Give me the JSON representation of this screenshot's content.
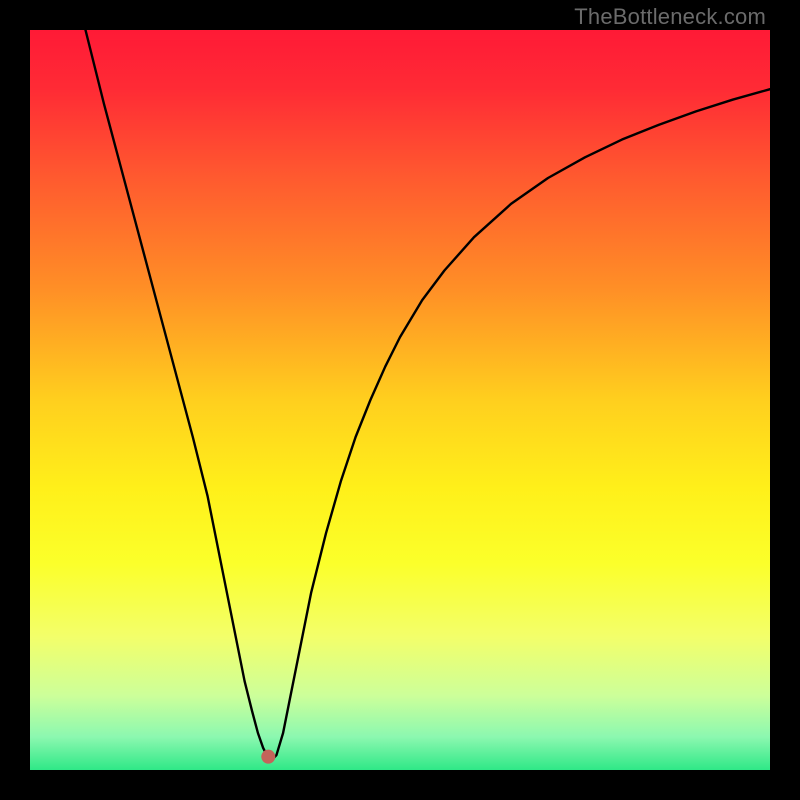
{
  "watermark": "TheBottleneck.com",
  "chart_data": {
    "type": "line",
    "title": "",
    "xlabel": "",
    "ylabel": "",
    "xlim": [
      0,
      100
    ],
    "ylim": [
      0,
      100
    ],
    "background_gradient": {
      "stops": [
        {
          "offset": 0.0,
          "color": "#ff1a36"
        },
        {
          "offset": 0.08,
          "color": "#ff2b35"
        },
        {
          "offset": 0.2,
          "color": "#ff5a2f"
        },
        {
          "offset": 0.35,
          "color": "#ff8f26"
        },
        {
          "offset": 0.5,
          "color": "#ffcf1e"
        },
        {
          "offset": 0.62,
          "color": "#fff01a"
        },
        {
          "offset": 0.72,
          "color": "#fbff2a"
        },
        {
          "offset": 0.82,
          "color": "#f3ff6a"
        },
        {
          "offset": 0.9,
          "color": "#ccff9a"
        },
        {
          "offset": 0.955,
          "color": "#8cf8b0"
        },
        {
          "offset": 1.0,
          "color": "#2fe887"
        }
      ]
    },
    "series": [
      {
        "name": "bottleneck-curve",
        "color": "#000000",
        "x": [
          7.5,
          10,
          12,
          14,
          16,
          18,
          20,
          22,
          24,
          26,
          27,
          28,
          29,
          30,
          30.8,
          31.5,
          32,
          32.4,
          32.8,
          33.3,
          34.2,
          35,
          36,
          37,
          38,
          40,
          42,
          44,
          46,
          48,
          50,
          53,
          56,
          60,
          65,
          70,
          75,
          80,
          85,
          90,
          95,
          100
        ],
        "values": [
          100,
          90,
          82.5,
          75,
          67.5,
          60,
          52.5,
          45,
          37,
          27,
          22,
          17,
          12,
          8,
          5,
          3,
          2,
          1.5,
          1.5,
          2,
          5,
          9,
          14,
          19,
          24,
          32,
          39,
          45,
          50,
          54.5,
          58.5,
          63.5,
          67.5,
          72,
          76.5,
          80,
          82.8,
          85.2,
          87.2,
          89,
          90.6,
          92
        ]
      }
    ],
    "minimum_marker": {
      "x": 32.2,
      "y": 1.8,
      "color": "#c4645a",
      "radius": 7
    }
  }
}
